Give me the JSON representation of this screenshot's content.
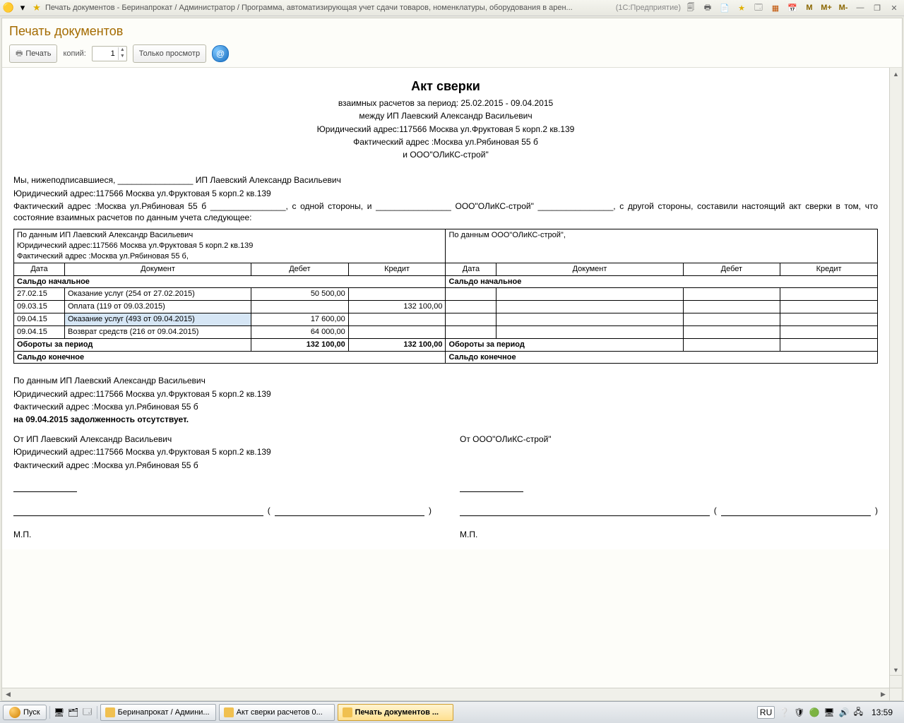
{
  "window": {
    "title": "Печать документов - Беринапрокат / Администратор / Программа, автоматизирующая учет сдачи товаров, номенклатуры, оборудования в арен...",
    "suffix": "(1С:Предприятие)",
    "m1": "M",
    "m2": "M+",
    "m3": "M-"
  },
  "page": {
    "title": "Печать документов",
    "print_label": "Печать",
    "copies_label": "копий:",
    "copies_value": "1",
    "preview_label": "Только просмотр"
  },
  "doc": {
    "title": "Акт сверки",
    "line1": "взаимных расчетов за период: 25.02.2015 - 09.04.2015",
    "line2": "между ИП Лаевский Александр Васильевич",
    "line3": "Юридический адрес:117566 Москва ул.Фруктовая 5 корп.2 кв.139",
    "line4": "Фактический адрес :Москва ул.Рябиновая 55 б",
    "line5": "и ООО\"ОЛиКС-строй\"",
    "intro1_a": "Мы, нижеподписавшиеся, ________________ ИП Лаевский Александр Васильевич",
    "intro2": "Юридический адрес:117566 Москва ул.Фруктовая 5 корп.2 кв.139",
    "intro3": "Фактический адрес :Москва ул.Рябиновая 55 б ________________, с одной стороны, и ________________ ООО\"ОЛиКС-строй\" ________________, с другой стороны, составили настоящий акт сверки в том, что состояние взаимных расчетов по данным учета следующее:",
    "left_header": "По данным ИП Лаевский Александр Васильевич",
    "left_addr1": "Юридический адрес:117566 Москва ул.Фруктовая 5 корп.2 кв.139",
    "left_addr2": "Фактический адрес :Москва ул.Рябиновая 55 б,",
    "right_header": "По данным ООО\"ОЛиКС-строй\",",
    "cols": {
      "date": "Дата",
      "doc": "Документ",
      "debit": "Дебет",
      "credit": "Кредит"
    },
    "saldo_start": "Сальдо начальное",
    "rows": [
      {
        "date": "27.02.15",
        "doc": "Оказание услуг (254 от 27.02.2015)",
        "debit": "50 500,00",
        "credit": ""
      },
      {
        "date": "09.03.15",
        "doc": "Оплата (119 от 09.03.2015)",
        "debit": "",
        "credit": "132 100,00"
      },
      {
        "date": "09.04.15",
        "doc": "Оказание услуг (493 от 09.04.2015)",
        "debit": "17 600,00",
        "credit": ""
      },
      {
        "date": "09.04.15",
        "doc": "Возврат средств (216 от 09.04.2015)",
        "debit": "64 000,00",
        "credit": ""
      }
    ],
    "turnover": "Обороты за период",
    "turn_debit": "132 100,00",
    "turn_credit": "132 100,00",
    "saldo_end": "Сальдо конечное",
    "footer1": "По данным ИП Лаевский Александр Васильевич",
    "footer2": "Юридический адрес:117566 Москва ул.Фруктовая 5 корп.2 кв.139",
    "footer3": "Фактический адрес :Москва ул.Рябиновая 55 б",
    "footer4": "на 09.04.2015 задолженность отсутствует.",
    "from_left1": "От ИП Лаевский Александр Васильевич",
    "from_left2": "Юридический адрес:117566 Москва ул.Фруктовая 5 корп.2 кв.139",
    "from_left3": "Фактический адрес :Москва ул.Рябиновая 55 б",
    "from_right": "От ООО\"ОЛиКС-строй\"",
    "mp": "М.П."
  },
  "taskbar": {
    "start": "Пуск",
    "task1": "Беринапрокат / Админи...",
    "task2": "Акт сверки расчетов 0...",
    "task3": "Печать документов ...",
    "lang": "RU",
    "clock": "13:59"
  }
}
